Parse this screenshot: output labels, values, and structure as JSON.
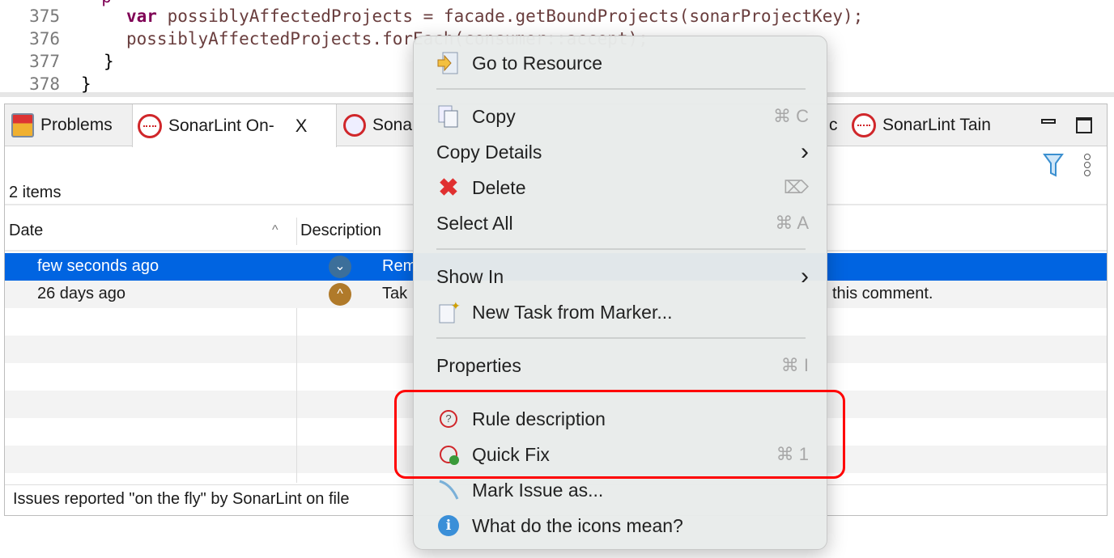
{
  "editor": {
    "lines": [
      {
        "num": "375",
        "kw": "var",
        "rest": " possiblyAffectedProjects = facade.getBoundProjects(sonarProjectKey);"
      },
      {
        "num": "376",
        "kw": "",
        "rest": "possiblyAffectedProjects.forEach(consumer::accept);"
      },
      {
        "num": "377",
        "kw": "",
        "rest": "}"
      },
      {
        "num": "378",
        "kw": "",
        "rest": "}"
      }
    ]
  },
  "tabs": [
    {
      "label": "Problems"
    },
    {
      "label": "SonarLint On-",
      "close": "X"
    },
    {
      "label": "Sona"
    },
    {
      "label": "c"
    },
    {
      "label": "SonarLint Tain"
    }
  ],
  "view": {
    "item_count": "2 items",
    "columns": [
      "Date",
      "Description"
    ],
    "sort_indicator": "^",
    "rows": [
      {
        "date": "few seconds ago",
        "desc": "Rem",
        "desc_tail": "",
        "selected": true,
        "severity": "minor"
      },
      {
        "date": "26 days ago",
        "desc": "Tak",
        "desc_tail": "this comment.",
        "selected": false,
        "severity": "major"
      }
    ],
    "status": "Issues reported \"on the fly\" by SonarLint on file"
  },
  "menu": {
    "items": [
      {
        "label": "Go to Resource",
        "shortcut": ""
      },
      {
        "label": "Copy",
        "shortcut": "⌘ C"
      },
      {
        "label": "Copy Details",
        "shortcut": "›"
      },
      {
        "label": "Delete",
        "shortcut": "⌦"
      },
      {
        "label": "Select All",
        "shortcut": "⌘ A"
      },
      {
        "label": "Show In",
        "shortcut": "›"
      },
      {
        "label": "New Task from Marker...",
        "shortcut": ""
      },
      {
        "label": "Properties",
        "shortcut": "⌘ I"
      },
      {
        "label": "Rule description",
        "shortcut": ""
      },
      {
        "label": "Quick Fix",
        "shortcut": "⌘ 1"
      },
      {
        "label": "Mark Issue as...",
        "shortcut": ""
      },
      {
        "label": "What do the icons mean?",
        "shortcut": ""
      }
    ]
  },
  "colors": {
    "selection": "#0064e1",
    "highlight": "#ff0000",
    "sonar": "#d0262a"
  }
}
